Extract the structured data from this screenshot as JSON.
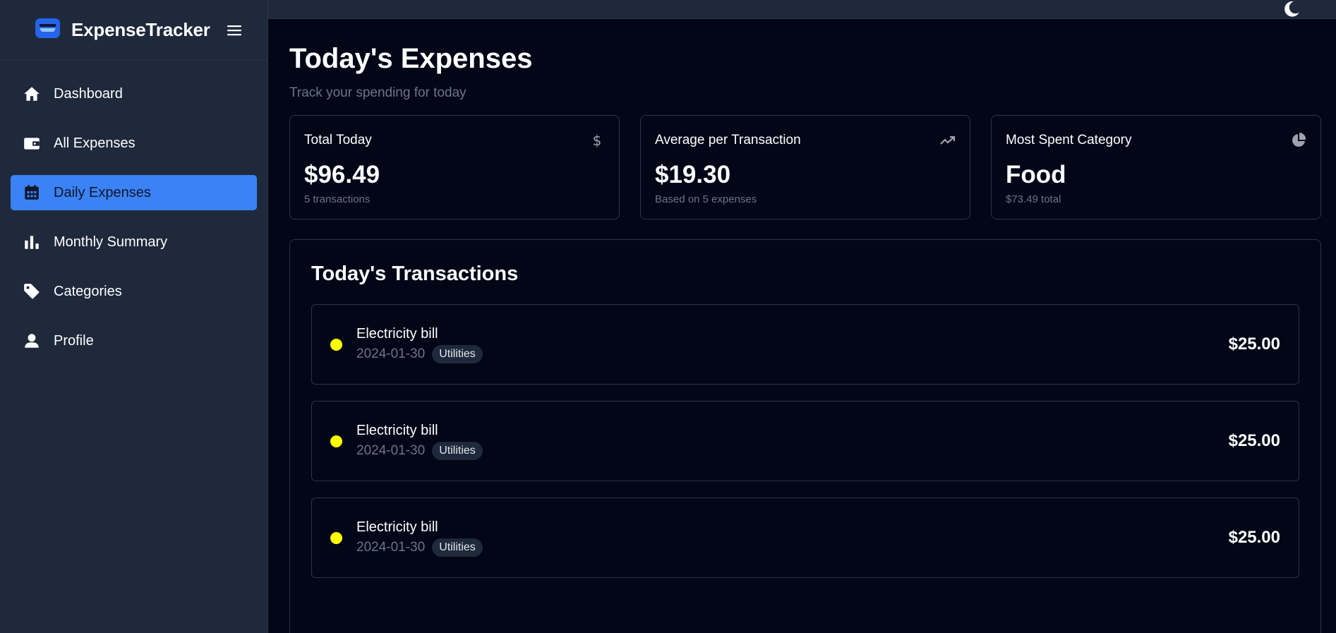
{
  "brand": {
    "name": "ExpenseTracker",
    "logo_icon": "wallet-icon",
    "menu_icon": "hamburger-icon"
  },
  "sidebar": {
    "items": [
      {
        "label": "Dashboard",
        "icon": "home-icon",
        "active": false
      },
      {
        "label": "All Expenses",
        "icon": "wallet-icon",
        "active": false
      },
      {
        "label": "Daily Expenses",
        "icon": "calendar-icon",
        "active": true
      },
      {
        "label": "Monthly Summary",
        "icon": "bar-chart-icon",
        "active": false
      },
      {
        "label": "Categories",
        "icon": "tag-icon",
        "active": false
      },
      {
        "label": "Profile",
        "icon": "user-icon",
        "active": false
      }
    ]
  },
  "topbar": {
    "theme_icon": "moon-icon"
  },
  "page": {
    "title": "Today's Expenses",
    "subtitle": "Track your spending for today"
  },
  "stats": [
    {
      "label": "Total Today",
      "value": "$96.49",
      "sub": "5 transactions",
      "icon": "dollar-icon"
    },
    {
      "label": "Average per Transaction",
      "value": "$19.30",
      "sub": "Based on 5 expenses",
      "icon": "trending-up-icon"
    },
    {
      "label": "Most Spent Category",
      "value": "Food",
      "sub": "$73.49 total",
      "icon": "pie-chart-icon"
    }
  ],
  "transactions": {
    "title": "Today's Transactions",
    "items": [
      {
        "description": "Electricity bill",
        "date": "2024-01-30",
        "category": "Utilities",
        "amount": "$25.00",
        "color": "#ffff00"
      },
      {
        "description": "Electricity bill",
        "date": "2024-01-30",
        "category": "Utilities",
        "amount": "$25.00",
        "color": "#ffff00"
      },
      {
        "description": "Electricity bill",
        "date": "2024-01-30",
        "category": "Utilities",
        "amount": "$25.00",
        "color": "#ffff00"
      }
    ]
  },
  "colors": {
    "accent": "#3b82f6",
    "sidebar_bg": "#1e293b",
    "content_bg": "#020617",
    "muted_text": "#6b7585",
    "category_dot": "#ffff00"
  }
}
